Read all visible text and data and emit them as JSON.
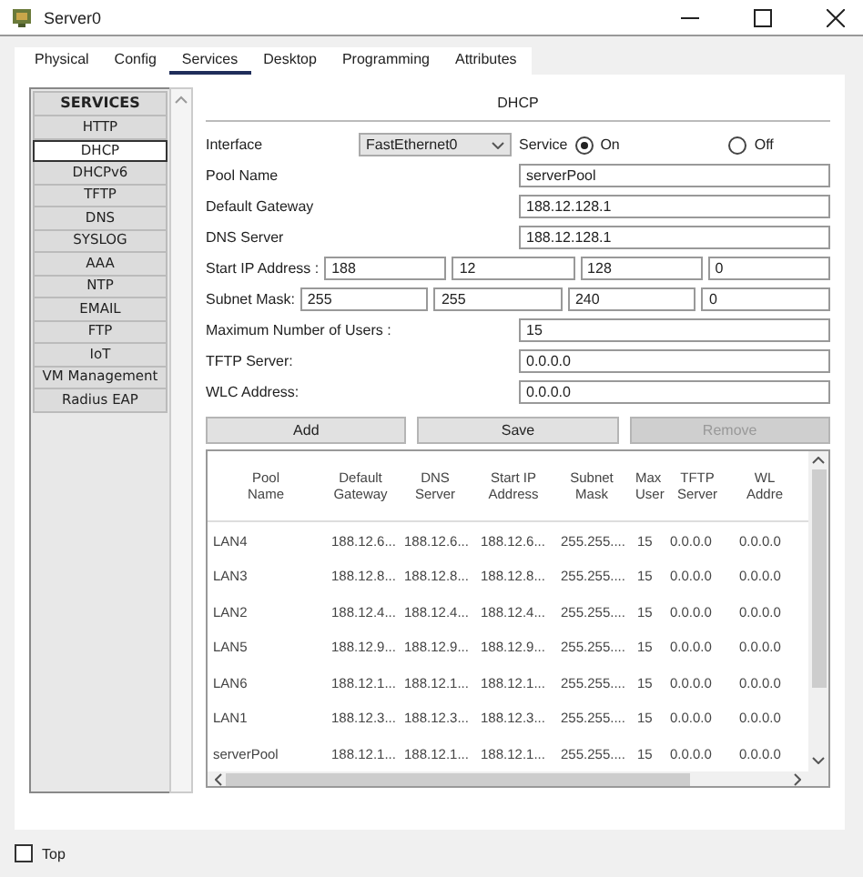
{
  "window": {
    "title": "Server0"
  },
  "tabs": [
    {
      "label": "Physical",
      "selected": false
    },
    {
      "label": "Config",
      "selected": false
    },
    {
      "label": "Services",
      "selected": true
    },
    {
      "label": "Desktop",
      "selected": false
    },
    {
      "label": "Programming",
      "selected": false
    },
    {
      "label": "Attributes",
      "selected": false
    }
  ],
  "services": {
    "heading": "SERVICES",
    "items": [
      {
        "label": "HTTP",
        "selected": false
      },
      {
        "label": "DHCP",
        "selected": true
      },
      {
        "label": "DHCPv6",
        "selected": false
      },
      {
        "label": "TFTP",
        "selected": false
      },
      {
        "label": "DNS",
        "selected": false
      },
      {
        "label": "SYSLOG",
        "selected": false
      },
      {
        "label": "AAA",
        "selected": false
      },
      {
        "label": "NTP",
        "selected": false
      },
      {
        "label": "EMAIL",
        "selected": false
      },
      {
        "label": "FTP",
        "selected": false
      },
      {
        "label": "IoT",
        "selected": false
      },
      {
        "label": "VM Management",
        "selected": false
      },
      {
        "label": "Radius EAP",
        "selected": false
      }
    ]
  },
  "dhcp": {
    "title": "DHCP",
    "interface": {
      "label": "Interface",
      "value": "FastEthernet0"
    },
    "service": {
      "label": "Service",
      "options": [
        {
          "label": "On",
          "selected": true
        },
        {
          "label": "Off",
          "selected": false
        }
      ]
    },
    "rows": [
      {
        "kind": "field",
        "label": "Pool Name",
        "value": "serverPool"
      },
      {
        "kind": "field",
        "label": "Default Gateway",
        "value": "188.12.128.1"
      },
      {
        "kind": "field",
        "label": "DNS Server",
        "value": "188.12.128.1"
      },
      {
        "kind": "octets",
        "label": "Start IP Address :",
        "values": [
          "188",
          "12",
          "128",
          "0"
        ]
      },
      {
        "kind": "octets",
        "label": "Subnet Mask:",
        "values": [
          "255",
          "255",
          "240",
          "0"
        ]
      },
      {
        "kind": "field",
        "label": "Maximum Number of Users :",
        "value": "15"
      },
      {
        "kind": "field",
        "label": "TFTP Server:",
        "value": "0.0.0.0"
      },
      {
        "kind": "field",
        "label": "WLC Address:",
        "value": "0.0.0.0"
      }
    ],
    "buttons": [
      {
        "label": "Add",
        "disabled": false
      },
      {
        "label": "Save",
        "disabled": false
      },
      {
        "label": "Remove",
        "disabled": true
      }
    ],
    "table": {
      "columns": [
        "Pool Name",
        "Default Gateway",
        "DNS Server",
        "Start IP Address",
        "Subnet Mask",
        "Max User",
        "TFTP Server",
        "WL Addre"
      ],
      "rows": [
        [
          "LAN4",
          "188.12.6...",
          "188.12.6...",
          "188.12.6...",
          "255.255....",
          "15",
          "0.0.0.0",
          "0.0.0.0"
        ],
        [
          "LAN3",
          "188.12.8...",
          "188.12.8...",
          "188.12.8...",
          "255.255....",
          "15",
          "0.0.0.0",
          "0.0.0.0"
        ],
        [
          "LAN2",
          "188.12.4...",
          "188.12.4...",
          "188.12.4...",
          "255.255....",
          "15",
          "0.0.0.0",
          "0.0.0.0"
        ],
        [
          "LAN5",
          "188.12.9...",
          "188.12.9...",
          "188.12.9...",
          "255.255....",
          "15",
          "0.0.0.0",
          "0.0.0.0"
        ],
        [
          "LAN6",
          "188.12.1...",
          "188.12.1...",
          "188.12.1...",
          "255.255....",
          "15",
          "0.0.0.0",
          "0.0.0.0"
        ],
        [
          "LAN1",
          "188.12.3...",
          "188.12.3...",
          "188.12.3...",
          "255.255....",
          "15",
          "0.0.0.0",
          "0.0.0.0"
        ],
        [
          "serverPool",
          "188.12.1...",
          "188.12.1...",
          "188.12.1...",
          "255.255....",
          "15",
          "0.0.0.0",
          "0.0.0.0"
        ]
      ]
    }
  },
  "footer": {
    "label": "Top",
    "checked": false
  }
}
